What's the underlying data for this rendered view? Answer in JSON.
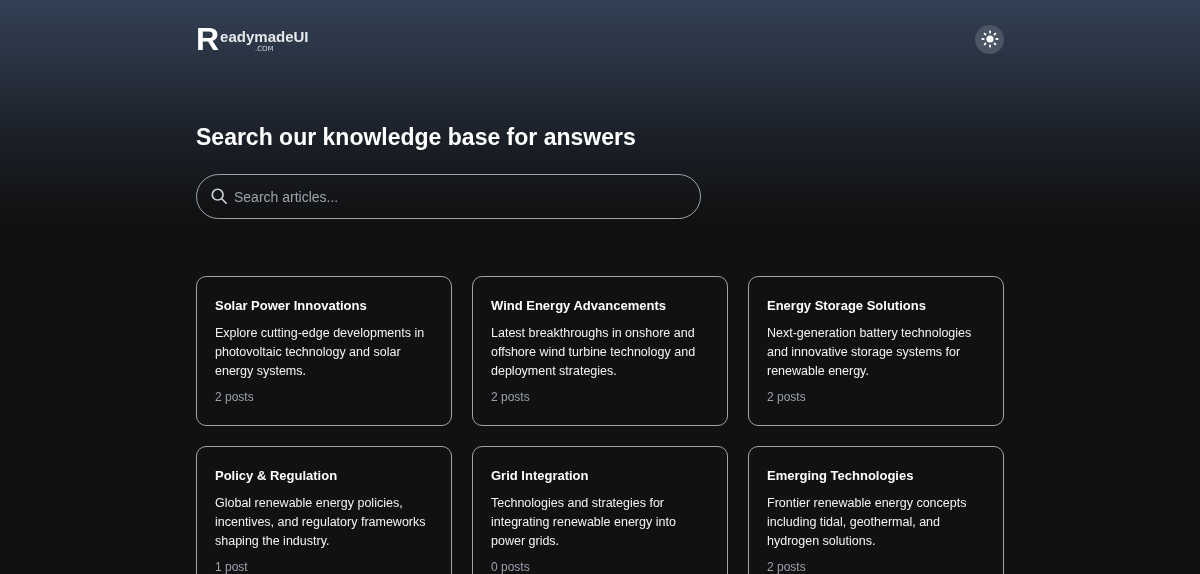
{
  "logo": {
    "initial": "R",
    "name": "eadymadeUI",
    "domain": ".COM"
  },
  "theme_toggle": {
    "kind": "light"
  },
  "heading": "Search our knowledge base for answers",
  "search": {
    "placeholder": "Search articles..."
  },
  "categories": [
    {
      "title": "Solar Power Innovations",
      "description": "Explore cutting-edge developments in photovoltaic technology and solar energy systems.",
      "count": "2 posts"
    },
    {
      "title": "Wind Energy Advancements",
      "description": "Latest breakthroughs in onshore and offshore wind turbine technology and deployment strategies.",
      "count": "2 posts"
    },
    {
      "title": "Energy Storage Solutions",
      "description": "Next-generation battery technologies and innovative storage systems for renewable energy.",
      "count": "2 posts"
    },
    {
      "title": "Policy & Regulation",
      "description": "Global renewable energy policies, incentives, and regulatory frameworks shaping the industry.",
      "count": "1 post"
    },
    {
      "title": "Grid Integration",
      "description": "Technologies and strategies for integrating renewable energy into power grids.",
      "count": "0 posts"
    },
    {
      "title": "Emerging Technologies",
      "description": "Frontier renewable energy concepts including tidal, geothermal, and hydrogen solutions.",
      "count": "2 posts"
    }
  ]
}
